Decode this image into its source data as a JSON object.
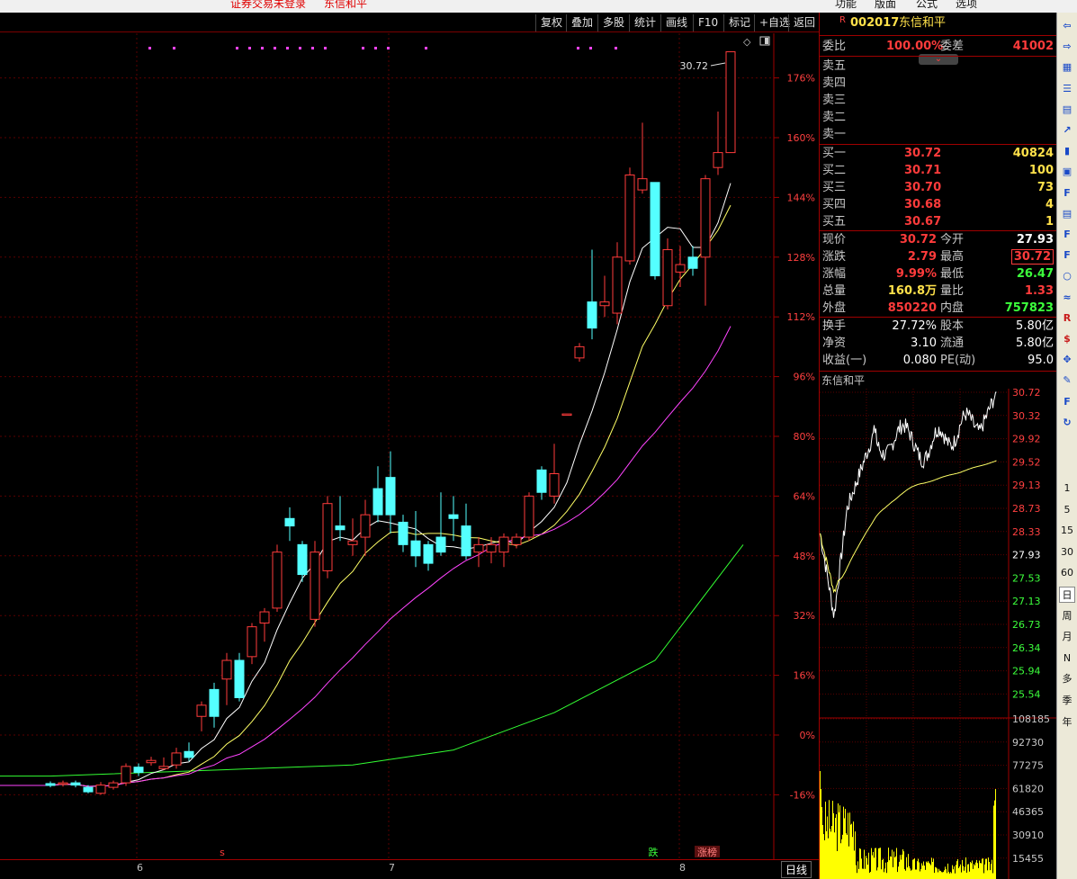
{
  "top_status": {
    "left_text": "证券交易未登录",
    "stock_name": "东信和平"
  },
  "top_menu": [
    "功能",
    "版面",
    "公式",
    "选项"
  ],
  "toolbar": [
    "复权",
    "叠加",
    "多股",
    "统计",
    "画线",
    "F10",
    "标记",
    "+自选",
    "返回"
  ],
  "chart": {
    "max_label": "30.72",
    "y_ticks": [
      "176%",
      "160%",
      "144%",
      "128%",
      "112%",
      "96%",
      "80%",
      "64%",
      "48%",
      "32%",
      "16%",
      "0%",
      "-16%"
    ],
    "x_ticks": [
      "6",
      "7",
      "8"
    ],
    "markers": [
      {
        "text": "s"
      },
      {
        "text": "跌"
      },
      {
        "text": "涨榜"
      }
    ],
    "period_label": "日线",
    "colors": {
      "up": "#ff3b3b",
      "down": "#54ffff",
      "ma5": "#ffffff",
      "ma10": "#ffff66",
      "ma20": "#ff44ff",
      "ma60": "#33ff33",
      "grid": "#5a0000",
      "pct_text": "#ff4040"
    }
  },
  "chart_data": {
    "type": "candlestick",
    "title": "",
    "y_range_pct": [
      -22,
      184
    ],
    "candles": [
      {
        "o": -13,
        "c": -13.5,
        "h": -12.4,
        "l": -14
      },
      {
        "o": -13,
        "c": -12.8,
        "h": -12.2,
        "l": -13.8
      },
      {
        "o": -12.8,
        "c": -13.4,
        "h": -12.2,
        "l": -14
      },
      {
        "o": -14,
        "c": -15.2,
        "h": -13.4,
        "l": -15.6
      },
      {
        "o": -15.6,
        "c": -13.4,
        "h": -12.6,
        "l": -16
      },
      {
        "o": -14,
        "c": -12.8,
        "h": -12.2,
        "l": -14.6
      },
      {
        "o": -12.8,
        "c": -8.4,
        "h": -7.6,
        "l": -13.6
      },
      {
        "o": -8.6,
        "c": -10,
        "h": -7.6,
        "l": -11
      },
      {
        "o": -7.4,
        "c": -6.8,
        "h": -5.8,
        "l": -8.2
      },
      {
        "o": -9,
        "c": -8.4,
        "h": -6,
        "l": -9.4
      },
      {
        "o": -8,
        "c": -4.8,
        "h": -3.4,
        "l": -9
      },
      {
        "o": -4.4,
        "c": -6,
        "h": -2,
        "l": -7
      },
      {
        "o": 5,
        "c": 8,
        "h": 9,
        "l": 1
      },
      {
        "o": 12.2,
        "c": 5,
        "h": 14,
        "l": 2
      },
      {
        "o": 15,
        "c": 20,
        "h": 22,
        "l": 8
      },
      {
        "o": 20,
        "c": 10,
        "h": 22,
        "l": 9
      },
      {
        "o": 21,
        "c": 29,
        "h": 30,
        "l": 19
      },
      {
        "o": 30,
        "c": 33,
        "h": 34,
        "l": 25
      },
      {
        "o": 34,
        "c": 49,
        "h": 51,
        "l": 33
      },
      {
        "o": 58,
        "c": 56,
        "h": 61,
        "l": 52
      },
      {
        "o": 51,
        "c": 43,
        "h": 52,
        "l": 41
      },
      {
        "o": 31,
        "c": 49,
        "h": 52,
        "l": 29
      },
      {
        "o": 44,
        "c": 62,
        "h": 64,
        "l": 42
      },
      {
        "o": 56,
        "c": 55,
        "h": 64,
        "l": 52
      },
      {
        "o": 51,
        "c": 52,
        "h": 58,
        "l": 48
      },
      {
        "o": 53,
        "c": 59,
        "h": 63,
        "l": 48
      },
      {
        "o": 66,
        "c": 59,
        "h": 72,
        "l": 57
      },
      {
        "o": 69,
        "c": 59,
        "h": 76,
        "l": 54
      },
      {
        "o": 57,
        "c": 51,
        "h": 59,
        "l": 49
      },
      {
        "o": 52,
        "c": 48,
        "h": 60,
        "l": 45
      },
      {
        "o": 51,
        "c": 46,
        "h": 52,
        "l": 44
      },
      {
        "o": 53,
        "c": 49,
        "h": 65,
        "l": 48
      },
      {
        "o": 59,
        "c": 58,
        "h": 64,
        "l": 52
      },
      {
        "o": 56,
        "c": 48,
        "h": 62,
        "l": 47
      },
      {
        "o": 49,
        "c": 51,
        "h": 53,
        "l": 45
      },
      {
        "o": 49,
        "c": 51,
        "h": 53,
        "l": 46
      },
      {
        "o": 49,
        "c": 53,
        "h": 54,
        "l": 45
      },
      {
        "o": 51,
        "c": 53,
        "h": 54,
        "l": 50
      },
      {
        "o": 53,
        "c": 64,
        "h": 65,
        "l": 52
      },
      {
        "o": 71,
        "c": 65,
        "h": 72,
        "l": 63
      },
      {
        "o": 64,
        "c": 70,
        "h": 78,
        "l": 62
      },
      {
        "o": 86,
        "c": 86,
        "h": 86,
        "l": 86
      },
      {
        "o": 101,
        "c": 104,
        "h": 105,
        "l": 100
      },
      {
        "o": 116,
        "c": 109,
        "h": 130,
        "l": 106
      },
      {
        "o": 115,
        "c": 116,
        "h": 123,
        "l": 112
      },
      {
        "o": 113,
        "c": 128,
        "h": 132,
        "l": 110
      },
      {
        "o": 127,
        "c": 150,
        "h": 152,
        "l": 126
      },
      {
        "o": 146,
        "c": 149,
        "h": 164,
        "l": 145
      },
      {
        "o": 148,
        "c": 123,
        "h": 148,
        "l": 122
      },
      {
        "o": 115,
        "c": 130,
        "h": 133,
        "l": 114
      },
      {
        "o": 124,
        "c": 126,
        "h": 131,
        "l": 120
      },
      {
        "o": 128,
        "c": 125,
        "h": 131,
        "l": 123
      },
      {
        "o": 128,
        "c": 149,
        "h": 150,
        "l": 115
      },
      {
        "o": 152,
        "c": 156,
        "h": 167,
        "l": 150
      },
      {
        "o": 156,
        "c": 183,
        "h": 183,
        "l": 156
      }
    ],
    "ma60": [
      [
        -12,
        -11
      ],
      [
        0,
        -11
      ],
      [
        8,
        -10
      ],
      [
        16,
        -9
      ],
      [
        24,
        -8
      ],
      [
        32,
        -4
      ],
      [
        40,
        6
      ],
      [
        48,
        20
      ],
      [
        55,
        51
      ]
    ]
  },
  "quote": {
    "code": "002017",
    "name": "东信和平",
    "wb_label": "委比",
    "wb_value": "100.00%",
    "wc_label": "委差",
    "wc_value": "41002",
    "sells": [
      {
        "label": "卖五"
      },
      {
        "label": "卖四"
      },
      {
        "label": "卖三"
      },
      {
        "label": "卖二"
      },
      {
        "label": "卖一"
      }
    ],
    "buys": [
      {
        "label": "买一",
        "price": "30.72",
        "vol": "40824"
      },
      {
        "label": "买二",
        "price": "30.71",
        "vol": "100"
      },
      {
        "label": "买三",
        "price": "30.70",
        "vol": "73"
      },
      {
        "label": "买四",
        "price": "30.68",
        "vol": "4"
      },
      {
        "label": "买五",
        "price": "30.67",
        "vol": "1"
      }
    ],
    "stats": [
      {
        "l1": "现价",
        "v1": "30.72",
        "l2": "今开",
        "v2": "27.93"
      },
      {
        "l1": "涨跌",
        "v1": "2.79",
        "l2": "最高",
        "v2": "30.72"
      },
      {
        "l1": "涨幅",
        "v1": "9.99%",
        "l2": "最低",
        "v2": "26.47"
      },
      {
        "l1": "总量",
        "v1": "160.8万",
        "l2": "量比",
        "v2": "1.33"
      },
      {
        "l1": "外盘",
        "v1": "850220",
        "l2": "内盘",
        "v2": "757823"
      }
    ],
    "fund": [
      {
        "l1": "换手",
        "v1": "27.72%",
        "l2": "股本",
        "v2": "5.80亿"
      },
      {
        "l1": "净资",
        "v1": "3.10",
        "l2": "流通",
        "v2": "5.80亿"
      },
      {
        "l1": "收益(一)",
        "v1": "0.080",
        "l2": "PE(动)",
        "v2": "95.0"
      }
    ]
  },
  "intraday": {
    "title": "东信和平",
    "price_ticks": [
      "30.72",
      "30.32",
      "29.92",
      "29.52",
      "29.13",
      "28.73",
      "28.33",
      "27.93",
      "27.53",
      "27.13",
      "26.73",
      "26.34",
      "25.94",
      "25.54"
    ],
    "vol_ticks": [
      "108185",
      "92730",
      "77275",
      "61820",
      "46365",
      "30910",
      "15455"
    ]
  },
  "side_icons": [
    "back-icon",
    "forward-icon",
    "grid-icon",
    "list-icon",
    "table-icon",
    "trend-icon",
    "kline-icon",
    "news-icon",
    "f10-icon",
    "note-icon",
    "f2-icon",
    "f6-icon",
    "circle-icon",
    "macd-icon",
    "rsi-icon",
    "money-icon",
    "move-icon",
    "pen-icon",
    "f5-icon",
    "refresh-icon"
  ],
  "periods": [
    "1",
    "5",
    "15",
    "30",
    "60",
    "日",
    "周",
    "月",
    "N",
    "多",
    "季",
    "年"
  ]
}
